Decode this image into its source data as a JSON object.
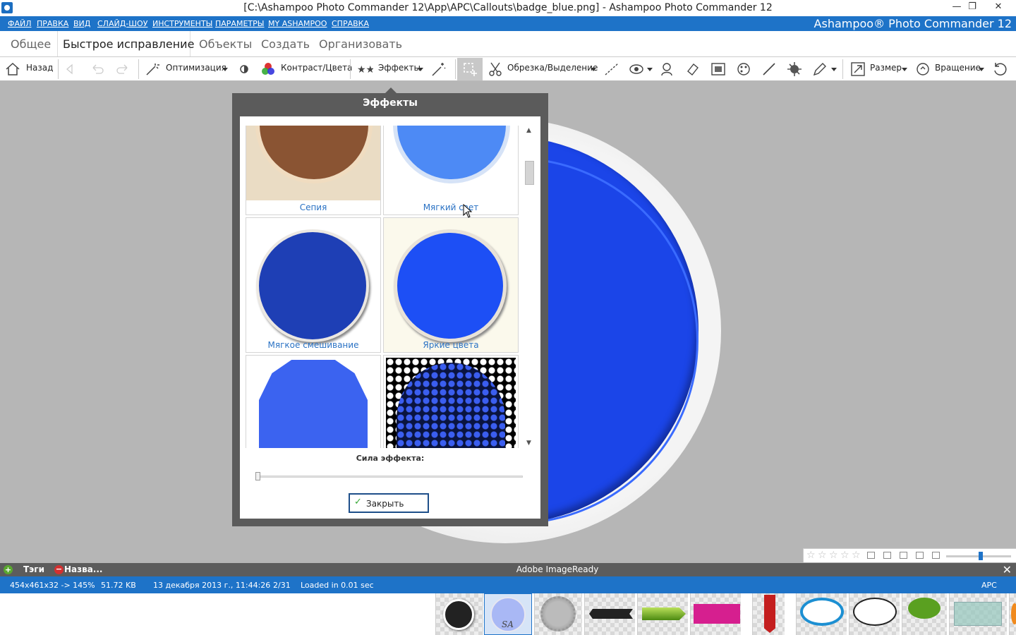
{
  "window": {
    "title": "[C:\\Ashampoo Photo Commander 12\\App\\APC\\Callouts\\badge_blue.png] - Ashampoo Photo Commander 12",
    "minimize": "—",
    "maximize": "❐",
    "close": "✕"
  },
  "menu": {
    "items": [
      "ФАЙЛ",
      "ПРАВКА",
      "ВИД",
      "СЛАЙД-ШОУ",
      "ИНСТРУМЕНТЫ",
      "ПАРАМЕТРЫ",
      "MY ASHAMPOO",
      "СПРАВКА"
    ],
    "brand": "Ashampoo® Photo Commander 12"
  },
  "tabs": [
    "Общее",
    "Быстрое исправление",
    "Объекты",
    "Создать",
    "Организовать"
  ],
  "active_tab": 1,
  "toolbar": {
    "back": "Назад",
    "optimize": "Оптимизация",
    "contrast": "Контраст/Цвета",
    "effects": "Эффекты",
    "crop": "Обрезка/Выделение",
    "size": "Размер",
    "rotate": "Вращение"
  },
  "dialog": {
    "title": "Эффекты",
    "thumbnails": [
      {
        "label": "Сепия"
      },
      {
        "label": "Мягкий свет"
      },
      {
        "label": "Мягкое смешивание"
      },
      {
        "label": "Яркие цвета"
      },
      {
        "label": ""
      },
      {
        "label": ""
      }
    ],
    "strength_label": "Сила эффекта:",
    "strength_value": 0,
    "close_label": "Закрыть"
  },
  "canvas": {
    "rating_stars": 5,
    "rating_filled": 0
  },
  "infobar": {
    "tags": "Тэги",
    "name": "Назва...",
    "center": "Adobe ImageReady",
    "close": "✕"
  },
  "status": {
    "dimensions": "454x461x32 -> 145%",
    "filesize": "51.72 KB",
    "date": "13 декабря 2013 г., 11:44:26",
    "position": "2/31",
    "loaded": "Loaded in 0.01 sec",
    "app": "APC"
  },
  "colors": {
    "accent": "#1e73c8",
    "badge": "#1b45e8",
    "canvas_bg": "#b6b6b6",
    "dialog_frame": "#5b5b5b"
  }
}
